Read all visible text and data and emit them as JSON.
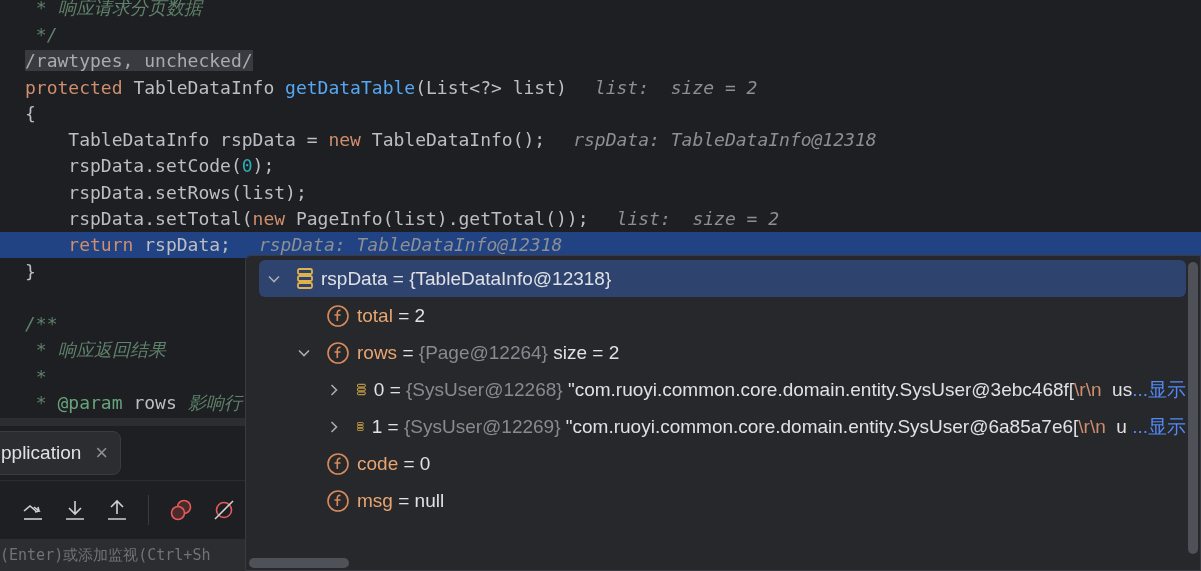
{
  "editor": {
    "lines": [
      {
        "tokens": [
          {
            "kind": "comment",
            "text": " * 响应请求分页数据"
          }
        ],
        "current": false
      },
      {
        "tokens": [
          {
            "kind": "comment",
            "text": " */"
          }
        ],
        "current": false
      },
      {
        "tokens": [
          {
            "kind": "annotation",
            "text": "/rawtypes, unchecked/"
          }
        ],
        "current": false
      },
      {
        "tokens": [
          {
            "kind": "keyword",
            "text": "protected "
          },
          {
            "kind": "plain",
            "text": "TableDataInfo "
          },
          {
            "kind": "method",
            "text": "getDataTable"
          },
          {
            "kind": "plain",
            "text": "(List<?> list)"
          }
        ],
        "hint": "list:  size = 2",
        "current": false
      },
      {
        "tokens": [
          {
            "kind": "plain",
            "text": "{"
          }
        ],
        "current": false
      },
      {
        "tokens": [
          {
            "kind": "plain",
            "text": "    TableDataInfo rspData = "
          },
          {
            "kind": "keyword",
            "text": "new "
          },
          {
            "kind": "plain",
            "text": "TableDataInfo();"
          }
        ],
        "hint": "rspData: TableDataInfo@12318",
        "current": false
      },
      {
        "tokens": [
          {
            "kind": "plain",
            "text": "    rspData.setCode("
          },
          {
            "kind": "number",
            "text": "0"
          },
          {
            "kind": "plain",
            "text": ");"
          }
        ],
        "current": false
      },
      {
        "tokens": [
          {
            "kind": "plain",
            "text": "    rspData.setRows(list);"
          }
        ],
        "current": false
      },
      {
        "tokens": [
          {
            "kind": "plain",
            "text": "    rspData.setTotal("
          },
          {
            "kind": "keyword",
            "text": "new "
          },
          {
            "kind": "plain",
            "text": "PageInfo(list).getTotal());"
          }
        ],
        "hint": "list:  size = 2",
        "current": false
      },
      {
        "tokens": [
          {
            "kind": "keyword",
            "text": "    return "
          },
          {
            "kind": "plain",
            "text": "rspData;"
          }
        ],
        "hint": "rspData: TableDataInfo@12318",
        "current": true
      },
      {
        "tokens": [
          {
            "kind": "plain",
            "text": "}"
          }
        ],
        "current": false
      },
      {
        "current": false
      },
      {
        "tokens": [
          {
            "kind": "comment",
            "text": "/**"
          }
        ],
        "current": false
      },
      {
        "tokens": [
          {
            "kind": "comment",
            "text": " * 响应返回结果"
          }
        ],
        "current": false
      },
      {
        "tokens": [
          {
            "kind": "comment",
            "text": " *"
          }
        ],
        "current": false
      },
      {
        "tokens": [
          {
            "kind": "comment",
            "text": " * "
          },
          {
            "kind": "doctag",
            "text": "@param"
          },
          {
            "kind": "plain",
            "text": " rows"
          },
          {
            "kind": "comment",
            "text": " 影响行"
          }
        ],
        "current": false
      }
    ]
  },
  "debug_panel": {
    "tab": {
      "label": "pplication",
      "close": "×"
    },
    "toolbar": [
      {
        "kind": "step-over"
      },
      {
        "kind": "step-into"
      },
      {
        "kind": "step-out"
      },
      {
        "kind": "breakpoints"
      },
      {
        "kind": "mute"
      }
    ],
    "watch_field": {
      "placeholder": "(Enter)或添加监视(Ctrl+Sh"
    }
  },
  "variables_popup": {
    "tree": [
      {
        "kind": "object",
        "sep": "=",
        "name": "rspData",
        "value": [
          {
            "kind": "plain",
            "text": "{TableDataInfo@12318}"
          }
        ],
        "selected": true,
        "expanded": true,
        "children": [
          {
            "kind": "field",
            "sep": "=",
            "name": "total",
            "value": [
              {
                "kind": "plain",
                "text": "2"
              }
            ],
            "selected": false
          },
          {
            "kind": "field",
            "sep": "=",
            "name": "rows",
            "value": [
              {
                "kind": "type",
                "text": "{Page@12264}"
              },
              {
                "kind": "plain",
                "text": " size = 2"
              }
            ],
            "selected": false,
            "expanded": true,
            "children": [
              {
                "kind": "object",
                "sep": "=",
                "name": "0",
                "value": [
                  {
                    "kind": "type",
                    "text": "{SysUser@12268}"
                  },
                  {
                    "kind": "plain",
                    "text": " \"com.ruoyi.common.core.domain.entity.SysUser@3ebc468f["
                  },
                  {
                    "kind": "escape",
                    "text": "\\r\\n"
                  },
                  {
                    "kind": "plain",
                    "text": "  us"
                  },
                  {
                    "kind": "link",
                    "text": "...显示"
                  }
                ],
                "selected": false,
                "expanded": false
              },
              {
                "kind": "object",
                "sep": "=",
                "name": "1",
                "value": [
                  {
                    "kind": "type",
                    "text": "{SysUser@12269}"
                  },
                  {
                    "kind": "plain",
                    "text": " \"com.ruoyi.common.core.domain.entity.SysUser@6a85a7e6["
                  },
                  {
                    "kind": "escape",
                    "text": "\\r\\n"
                  },
                  {
                    "kind": "plain",
                    "text": "  u "
                  },
                  {
                    "kind": "link",
                    "text": "...显示"
                  }
                ],
                "selected": false,
                "expanded": false
              }
            ]
          },
          {
            "kind": "field",
            "sep": "=",
            "name": "code",
            "value": [
              {
                "kind": "plain",
                "text": "0"
              }
            ],
            "selected": false
          },
          {
            "kind": "field",
            "sep": "=",
            "name": "msg",
            "value": [
              {
                "kind": "plain",
                "text": "null"
              }
            ],
            "selected": false
          }
        ]
      }
    ]
  }
}
